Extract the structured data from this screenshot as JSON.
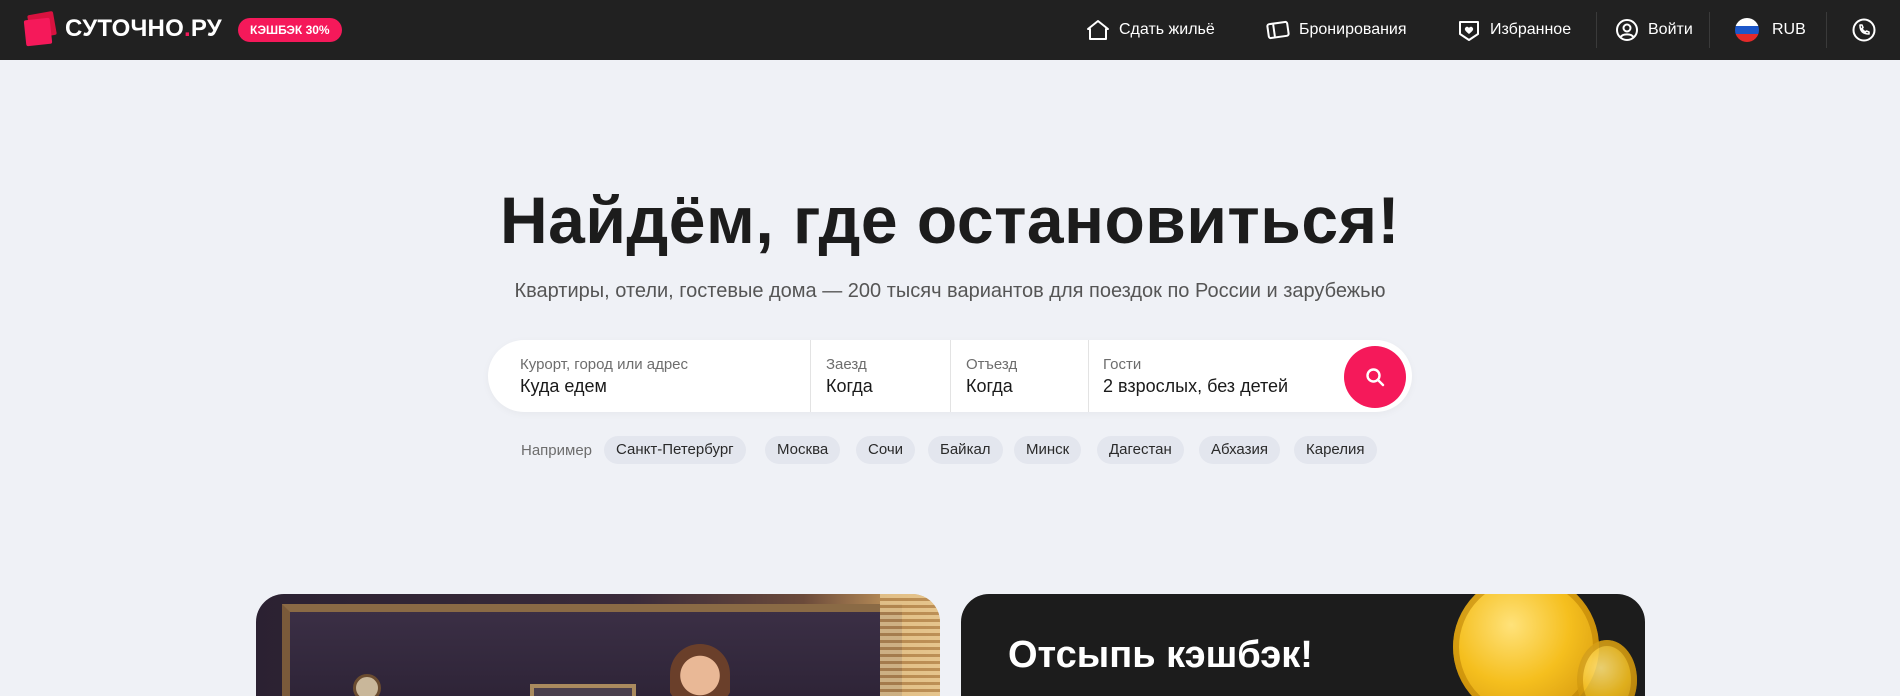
{
  "header": {
    "logo_main": "СУТОЧНО",
    "logo_dot": ".",
    "logo_tail": "РУ",
    "cashback_badge": "КЭШБЭК 30%",
    "nav": {
      "rent_out": "Сдать жильё",
      "bookings": "Бронирования",
      "favorites": "Избранное",
      "login": "Войти",
      "currency": "RUB"
    },
    "icons": [
      "house-icon",
      "ticket-icon",
      "heart-icon",
      "user-icon",
      "russia-flag-icon",
      "phone-icon"
    ]
  },
  "hero": {
    "title": "Найдём, где остановиться!",
    "subtitle": "Квартиры, отели, гостевые дома — 200 тысяч вариантов для поездок по России и зарубежью"
  },
  "search": {
    "destination_label": "Курорт, город или адрес",
    "destination_value": "Куда едем",
    "checkin_label": "Заезд",
    "checkin_value": "Когда",
    "checkout_label": "Отъезд",
    "checkout_value": "Когда",
    "guests_label": "Гости",
    "guests_value": "2 взрослых, без детей"
  },
  "examples": {
    "label": "Например",
    "chips": [
      "Санкт-Петербург",
      "Москва",
      "Сочи",
      "Байкал",
      "Минск",
      "Дагестан",
      "Абхазия",
      "Карелия"
    ]
  },
  "promo": {
    "right_title": "Отсыпь кэшбэк!"
  },
  "colors": {
    "brand": "#f5195a",
    "header_bg": "#212121",
    "page_bg": "#eff1f6"
  }
}
